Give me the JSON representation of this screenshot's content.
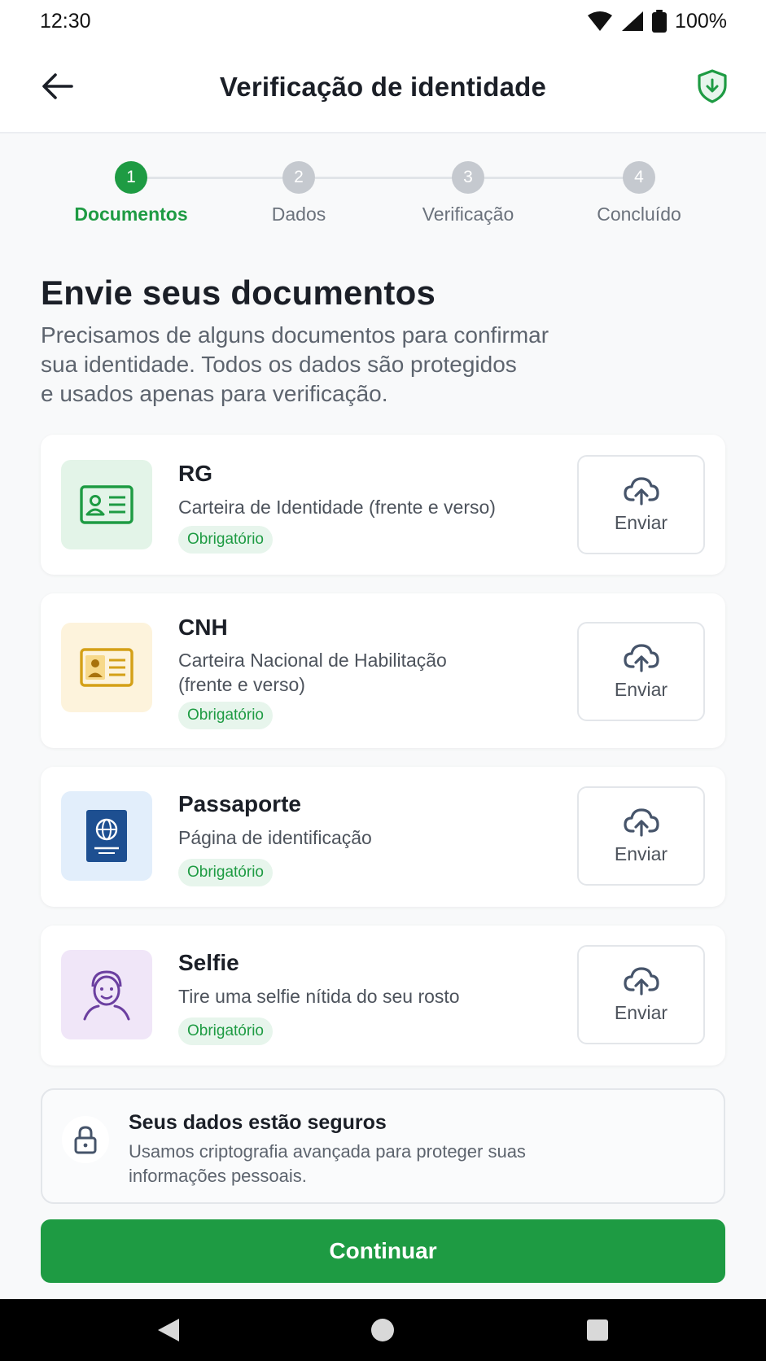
{
  "status_bar": {
    "time": "12:30",
    "battery": "100%"
  },
  "header": {
    "title": "Verificação de identidade",
    "back_icon": "arrow-left-icon",
    "shield_icon": "shield-check-icon"
  },
  "stepper": {
    "active_step": 1,
    "steps": [
      {
        "number": "1",
        "label": "Documentos"
      },
      {
        "number": "2",
        "label": "Dados"
      },
      {
        "number": "3",
        "label": "Verificação"
      },
      {
        "number": "4",
        "label": "Concluído"
      }
    ]
  },
  "main": {
    "heading": "Envie seus documentos",
    "intro_lines": [
      "Precisamos de alguns documentos para confirmar",
      "sua identidade. Todos os dados são protegidos",
      "e usados apenas para verificação."
    ]
  },
  "documents": [
    {
      "title": "RG",
      "desc_lines": [
        "Carteira de Identidade (frente e verso)"
      ],
      "badge": "Obrigatório",
      "upload_label": "Enviar",
      "icon": "id-card-icon",
      "icon_bg": "#e3f4e8",
      "icon_color": "#1e9b43"
    },
    {
      "title": "CNH",
      "desc_lines": [
        "Carteira Nacional de Habilitação",
        "(frente e verso)"
      ],
      "badge": "Obrigatório",
      "upload_label": "Enviar",
      "icon": "driver-license-icon",
      "icon_bg": "#fdf3dc",
      "icon_color": "#d4a017"
    },
    {
      "title": "Passaporte",
      "desc_lines": [
        "Página de identificação"
      ],
      "badge": "Obrigatório",
      "upload_label": "Enviar",
      "icon": "passport-icon",
      "icon_bg": "#e2eefb",
      "icon_color": "#1d4f91"
    },
    {
      "title": "Selfie",
      "desc_lines": [
        "Tire uma selfie nítida do seu rosto"
      ],
      "badge": "Obrigatório",
      "upload_label": "Enviar",
      "icon": "selfie-face-icon",
      "icon_bg": "#f0e6f8",
      "icon_color": "#6b3fa0"
    }
  ],
  "security": {
    "title": "Seus dados estão seguros",
    "desc_lines": [
      "Usamos criptografia avançada para proteger suas",
      "informações pessoais."
    ],
    "icon": "lock-icon"
  },
  "cta": {
    "label": "Continuar"
  },
  "colors": {
    "accent": "#1e9b43",
    "badge_bg": "#e7f5ec"
  }
}
